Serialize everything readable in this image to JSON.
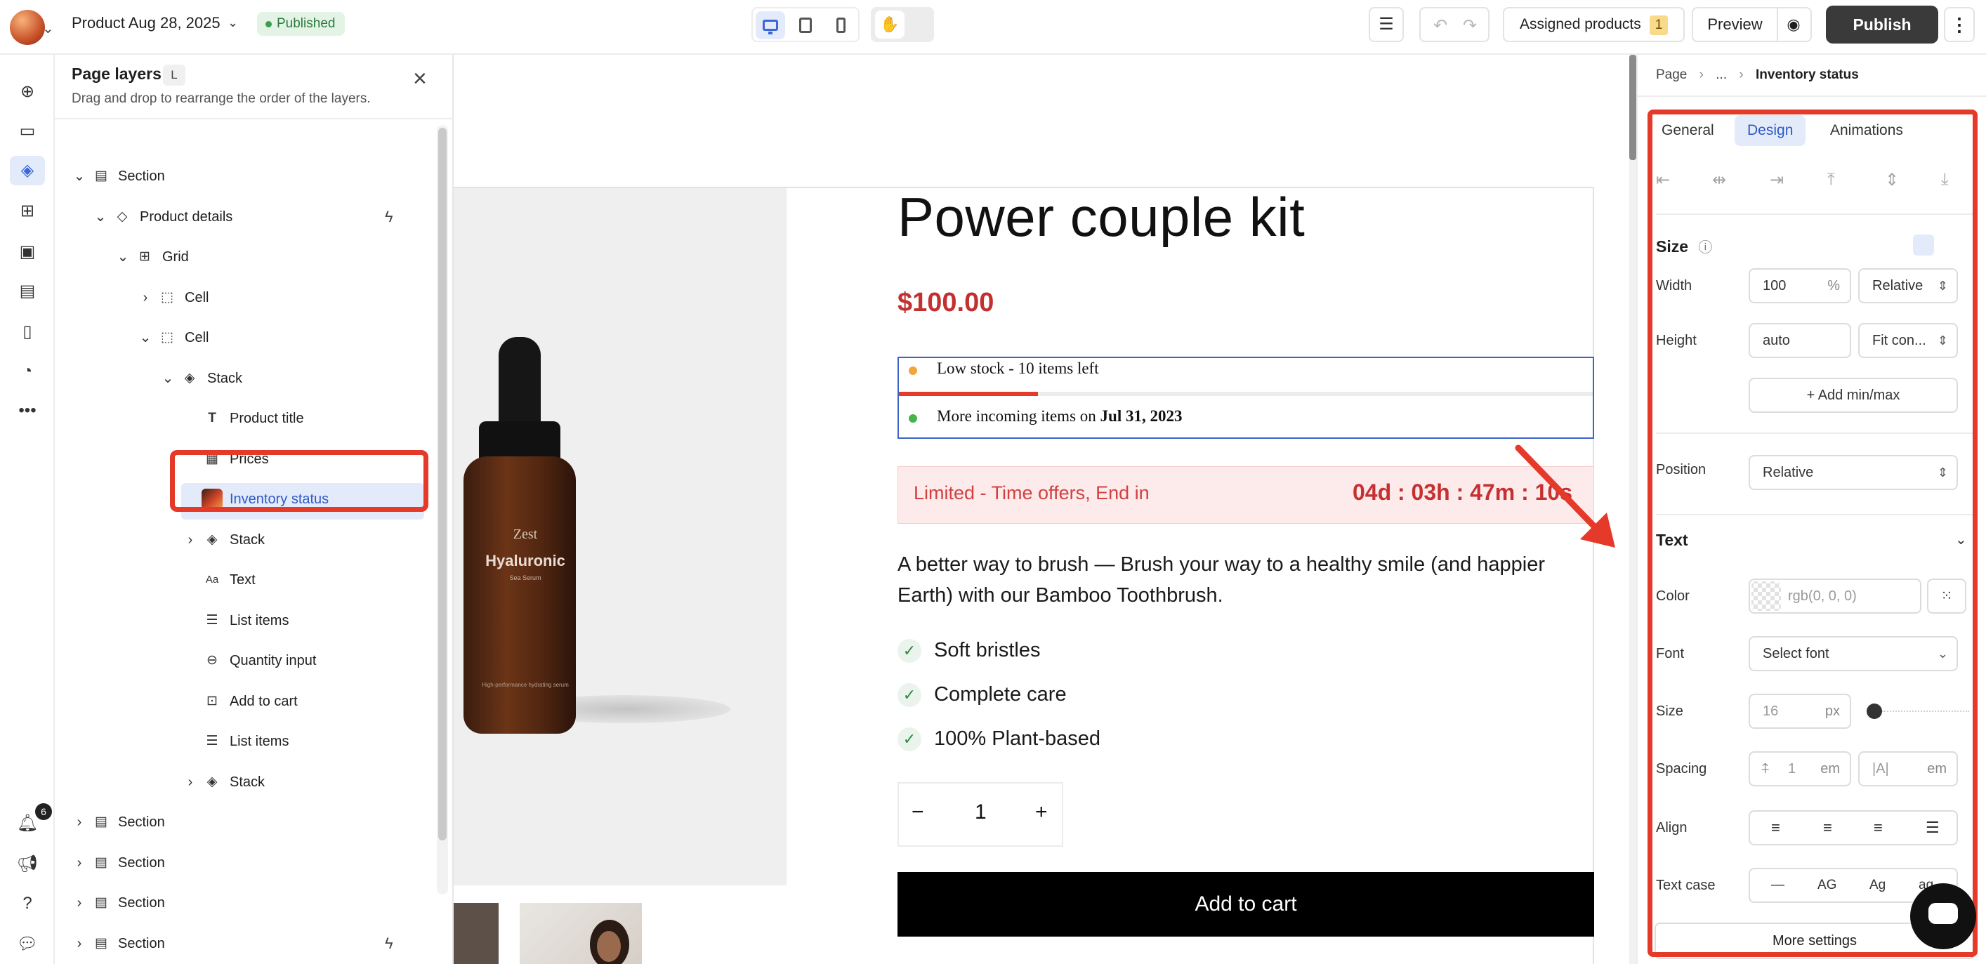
{
  "topbar": {
    "title": "Product Aug 28, 2025",
    "status": "Published",
    "assigned_label": "Assigned products",
    "assigned_count": "1",
    "preview_label": "Preview",
    "publish_label": "Publish"
  },
  "rail": {
    "notification_count": "6"
  },
  "layers": {
    "title": "Page layers",
    "shortcut": "L",
    "subtitle": "Drag and drop to rearrange the order of the layers.",
    "items": [
      {
        "label": "Section"
      },
      {
        "label": "Product details"
      },
      {
        "label": "Grid"
      },
      {
        "label": "Cell"
      },
      {
        "label": "Cell"
      },
      {
        "label": "Stack"
      },
      {
        "label": "Product title"
      },
      {
        "label": "Prices"
      },
      {
        "label": "Inventory status"
      },
      {
        "label": "Stack"
      },
      {
        "label": "Text"
      },
      {
        "label": "List items"
      },
      {
        "label": "Quantity input"
      },
      {
        "label": "Add to cart"
      },
      {
        "label": "List items"
      },
      {
        "label": "Stack"
      },
      {
        "label": "Section"
      },
      {
        "label": "Section"
      },
      {
        "label": "Section"
      },
      {
        "label": "Section"
      }
    ]
  },
  "product": {
    "title": "Power couple kit",
    "price": "$100.00",
    "bottle_brand": "Zest",
    "bottle_name": "Hyaluronic",
    "bottle_sub": "Sea Serum",
    "bottle_small": "High-performance hydrating serum",
    "inventory_low": "Low stock - 10 items left",
    "inventory_incoming_prefix": "More incoming items on ",
    "inventory_incoming_date": "Jul 31, 2023",
    "stock_fraction": 0.2,
    "timer_label": "Limited - Time offers, End in",
    "timer_value": "04d : 03h : 47m : 10s",
    "description": "A better way to brush — Brush your way to a healthy smile (and happier Earth) with our Bamboo Toothbrush.",
    "features": [
      "Soft bristles",
      "Complete care",
      "100% Plant-based"
    ],
    "quantity": "1",
    "qty_minus": "−",
    "qty_plus": "+",
    "add_to_cart": "Add to cart"
  },
  "panel": {
    "breadcrumb_root": "Page",
    "breadcrumb_mid": "...",
    "breadcrumb_current": "Inventory status",
    "tabs": [
      "General",
      "Design",
      "Animations"
    ],
    "size_heading": "Size",
    "width_label": "Width",
    "width_value": "100",
    "width_unit": "%",
    "width_mode": "Relative",
    "height_label": "Height",
    "height_value": "auto",
    "height_mode": "Fit con...",
    "add_minmax": "Add min/max",
    "position_label": "Position",
    "position_value": "Relative",
    "text_heading": "Text",
    "color_label": "Color",
    "color_value": "rgb(0, 0, 0)",
    "font_label": "Font",
    "font_value": "Select font",
    "fontsize_label": "Size",
    "fontsize_value": "16",
    "fontsize_unit": "px",
    "spacing_label": "Spacing",
    "line_height_value": "1",
    "spacing_unit": "em",
    "letter_spacing_value": "|A|",
    "letter_spacing_unit": "em",
    "align_label": "Align",
    "textcase_label": "Text case",
    "textcase_options": [
      "—",
      "AG",
      "Ag",
      "ag"
    ],
    "more_settings": "More settings"
  },
  "colors": {
    "accent_blue": "#3b66d6",
    "highlight_red": "#e53929",
    "price_red": "#c2302f",
    "publish_bg": "#3a3a3a"
  }
}
